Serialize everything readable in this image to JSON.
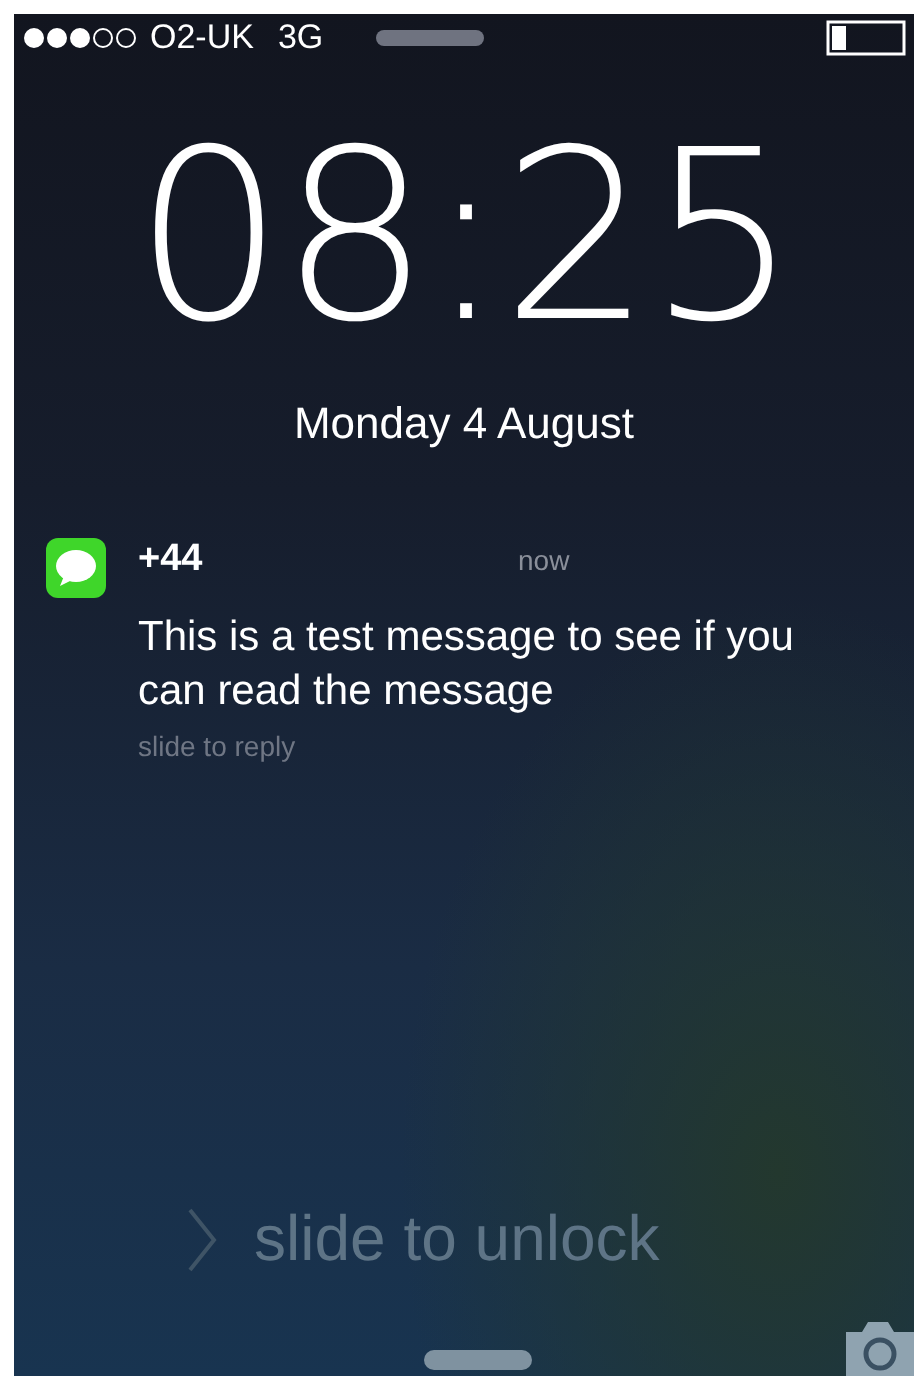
{
  "status_bar": {
    "carrier": "O2-UK",
    "network": "3G"
  },
  "clock": {
    "time": "08:25",
    "date": "Monday 4 August"
  },
  "notification": {
    "sender": "+44",
    "time": "now",
    "message": "This is a test message to see if you can read the message",
    "hint": "slide to reply"
  },
  "unlock": {
    "label": "slide to unlock"
  }
}
